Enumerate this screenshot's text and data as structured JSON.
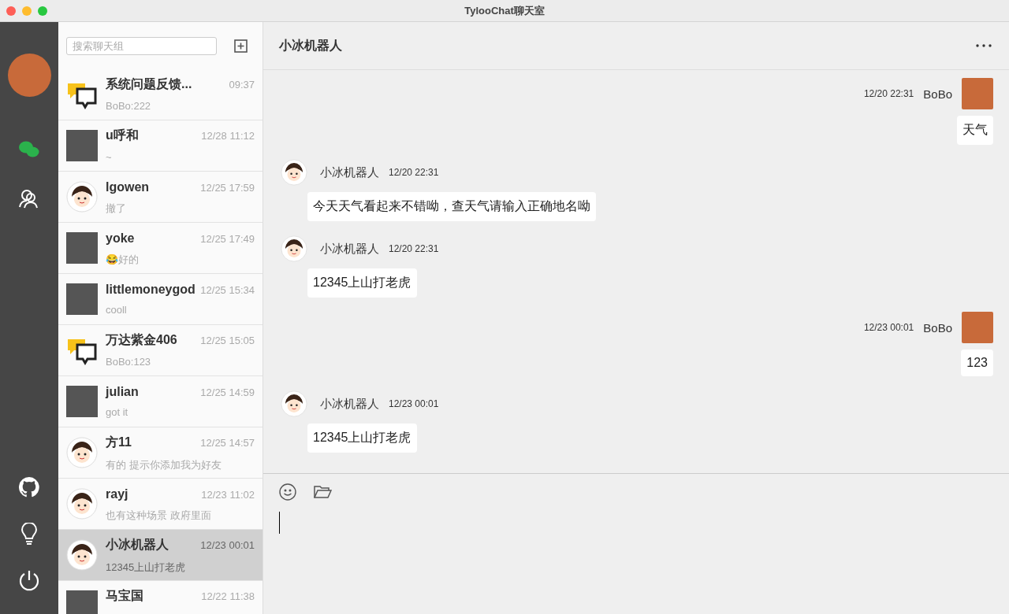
{
  "window": {
    "title": "TylooChat聊天室"
  },
  "nav": {
    "items": [
      {
        "kind": "chat",
        "selected": true
      },
      {
        "kind": "contacts",
        "selected": false
      }
    ],
    "bottom": [
      {
        "kind": "github"
      },
      {
        "kind": "bulb"
      },
      {
        "kind": "power"
      }
    ]
  },
  "search": {
    "placeholder": "搜索聊天组"
  },
  "chats": [
    {
      "kind": "group",
      "name": "系统问题反馈...",
      "time": "09:37",
      "preview": "BoBo:222",
      "selected": false
    },
    {
      "kind": "photo",
      "name": "u呼和",
      "time": "12/28 11:12",
      "preview": "~",
      "selected": false
    },
    {
      "kind": "cartoon",
      "name": "lgowen",
      "time": "12/25 17:59",
      "preview": "撤了",
      "selected": false
    },
    {
      "kind": "photo",
      "name": "yoke",
      "time": "12/25 17:49",
      "preview": "😂好的",
      "selected": false
    },
    {
      "kind": "photo",
      "name": "littlemoneygod",
      "time": "12/25 15:34",
      "preview": "cooll",
      "selected": false
    },
    {
      "kind": "group",
      "name": "万达紫金406",
      "time": "12/25 15:05",
      "preview": "BoBo:123",
      "selected": false
    },
    {
      "kind": "photo",
      "name": "julian",
      "time": "12/25 14:59",
      "preview": "got it",
      "selected": false
    },
    {
      "kind": "cartoon",
      "name": "方11",
      "time": "12/25 14:57",
      "preview": "有的 提示你添加我为好友",
      "selected": false
    },
    {
      "kind": "cartoon",
      "name": "rayj",
      "time": "12/23 11:02",
      "preview": "也有这种场景 政府里面",
      "selected": false
    },
    {
      "kind": "cartoon",
      "name": "小冰机器人",
      "time": "12/23 00:01",
      "preview": "12345上山打老虎",
      "selected": true
    },
    {
      "kind": "photo",
      "name": "马宝国",
      "time": "12/22 11:38",
      "selected": false
    }
  ],
  "conversation": {
    "title": "小冰机器人",
    "messages": [
      {
        "kind": "sent",
        "sender": "BoBo",
        "time": "12/20 22:31",
        "text": "天气"
      },
      {
        "kind": "received",
        "sender": "小冰机器人",
        "time": "12/20 22:31",
        "text": "今天天气看起来不错呦，查天气请输入正确地名呦"
      },
      {
        "kind": "received",
        "sender": "小冰机器人",
        "time": "12/20 22:31",
        "text": "12345上山打老虎"
      },
      {
        "kind": "sent",
        "sender": "BoBo",
        "time": "12/23 00:01",
        "text": "123"
      },
      {
        "kind": "received",
        "sender": "小冰机器人",
        "time": "12/23 00:01",
        "text": "12345上山打老虎"
      }
    ]
  }
}
